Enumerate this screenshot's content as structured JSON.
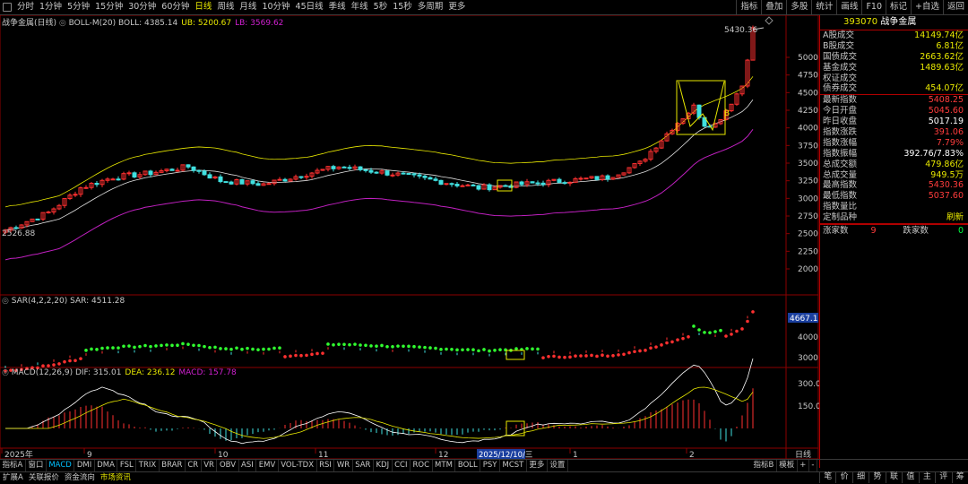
{
  "toolbar": {
    "periods": [
      "分时",
      "1分钟",
      "5分钟",
      "15分钟",
      "30分钟",
      "60分钟",
      "日线",
      "周线",
      "月线",
      "10分钟",
      "45日线",
      "季线",
      "年线",
      "5秒",
      "15秒",
      "多周期",
      "更多"
    ],
    "active_period": "日线",
    "tools": [
      "指标",
      "叠加",
      "多股",
      "统计",
      "画线",
      "F10",
      "标记",
      "+自选",
      "返回"
    ]
  },
  "chart": {
    "name": "战争金属(日线)",
    "boll_label": "BOLL-M(20)",
    "boll_values": "BOLL: 4385.14 UB: 5200.67 LB: 3569.62",
    "high_label": "5430.36",
    "low_label": "2526.88",
    "price_axis": [
      "5000",
      "4750",
      "4500",
      "4250",
      "4000",
      "3750",
      "3500",
      "3250",
      "3000",
      "2750",
      "2500",
      "2250",
      "2000"
    ],
    "sar_label": "SAR(4,2,2,20)",
    "sar_value": "SAR: 4511.28",
    "sar_axis": [
      "4000",
      "3000"
    ],
    "sar_current": "4667.1",
    "macd_label": "MACD(12,26,9)",
    "macd_values": "DIF: 315.01 DEA: 236.12 MACD: 157.78",
    "macd_axis": [
      "300.0",
      "150.0"
    ],
    "date_axis": [
      "2025年",
      "9",
      "10",
      "11",
      "12",
      "1",
      "2"
    ],
    "date_cursor": "2025/12/10/三",
    "date_mode": "日线"
  },
  "panel": {
    "code": "393070",
    "name": "战争金属",
    "rows": [
      {
        "label": "A股成交",
        "value": "14149.74亿",
        "color": "#e8e800"
      },
      {
        "label": "B股成交",
        "value": "6.81亿",
        "color": "#e8e800"
      },
      {
        "label": "国债成交",
        "value": "2663.62亿",
        "color": "#e8e800"
      },
      {
        "label": "基金成交",
        "value": "1489.63亿",
        "color": "#e8e800"
      },
      {
        "label": "权证成交",
        "value": "",
        "color": "#e8e800"
      },
      {
        "label": "债券成交",
        "value": "454.07亿",
        "color": "#e8e800"
      },
      {
        "label": "最新指数",
        "value": "5408.25",
        "color": "#ff3c3c"
      },
      {
        "label": "今日开盘",
        "value": "5045.60",
        "color": "#ff3c3c"
      },
      {
        "label": "昨日收盘",
        "value": "5017.19",
        "color": "#ffffff"
      },
      {
        "label": "指数涨跌",
        "value": "391.06",
        "color": "#ff3c3c"
      },
      {
        "label": "指数涨幅",
        "value": "7.79%",
        "color": "#ff3c3c"
      },
      {
        "label": "指数振幅",
        "value": "392.76/7.83%",
        "color": "#ffffff"
      },
      {
        "label": "总成交额",
        "value": "479.86亿",
        "color": "#e8e800"
      },
      {
        "label": "总成交量",
        "value": "949.5万",
        "color": "#e8e800"
      },
      {
        "label": "最高指数",
        "value": "5430.36",
        "color": "#ff3c3c"
      },
      {
        "label": "最低指数",
        "value": "5037.60",
        "color": "#ff3c3c"
      },
      {
        "label": "指数量比",
        "value": "",
        "color": "#e8e800"
      },
      {
        "label": "定制品种",
        "value": "刷新",
        "color": "#e8e800"
      }
    ],
    "up_label": "涨家数",
    "up_value": "9",
    "down_label": "跌家数",
    "down_value": "0"
  },
  "indicators": [
    "指标A",
    "窗口",
    "MACD",
    "DMI",
    "DMA",
    "FSL",
    "TRIX",
    "BRAR",
    "CR",
    "VR",
    "OBV",
    "ASI",
    "EMV",
    "VOL-TDX",
    "RSI",
    "WR",
    "SAR",
    "KDJ",
    "CCI",
    "ROC",
    "MTM",
    "BOLL",
    "PSY",
    "MCST",
    "更多",
    "设置"
  ],
  "active_indicator": "MACD",
  "indicator_right": [
    "指标B",
    "模板",
    "+",
    "-"
  ],
  "status": [
    "扩展A",
    "关联报价",
    "资金流向",
    "市场资讯"
  ],
  "active_status": "市场资讯",
  "right_tabs": [
    "笔",
    "价",
    "细",
    "势",
    "联",
    "值",
    "主",
    "评",
    "筹"
  ]
}
